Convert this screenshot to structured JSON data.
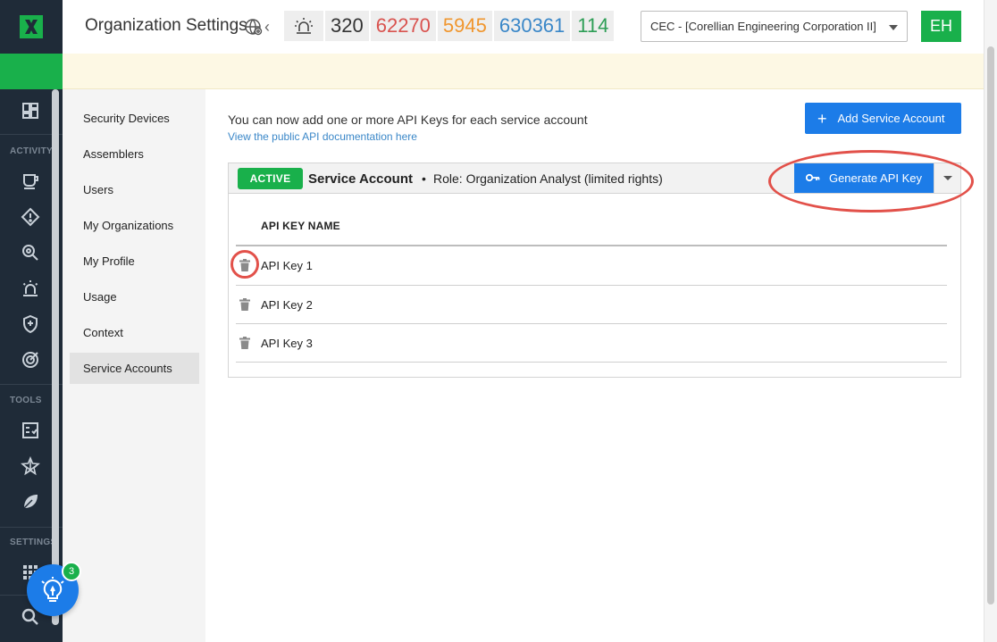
{
  "header": {
    "title": "Organization Settings",
    "stats": [
      {
        "value": "320",
        "color": "#333333"
      },
      {
        "value": "62270",
        "color": "#d9534f"
      },
      {
        "value": "5945",
        "color": "#f0962e"
      },
      {
        "value": "630361",
        "color": "#3a87c8"
      },
      {
        "value": "114",
        "color": "#2e9e56"
      }
    ],
    "org_selected": "CEC - [Corellian Engineering Corporation II]",
    "avatar_initials": "EH"
  },
  "rail": {
    "sections": {
      "activity": "ACTIVITY",
      "tools": "TOOLS",
      "settings": "SETTINGS"
    },
    "icons": [
      "dashboard-icon",
      "activity-cup-icon",
      "alert-diamond-icon",
      "threat-search-icon",
      "alarm-icon",
      "shield-icon",
      "target-icon",
      "checklist-icon",
      "network-star-icon",
      "leaf-icon",
      "grid-icon",
      "search-icon"
    ]
  },
  "subnav": {
    "items": [
      {
        "label": "Security Devices"
      },
      {
        "label": "Assemblers"
      },
      {
        "label": "Users"
      },
      {
        "label": "My Organizations"
      },
      {
        "label": "My Profile"
      },
      {
        "label": "Usage"
      },
      {
        "label": "Context"
      },
      {
        "label": "Service Accounts"
      }
    ],
    "active": "Service Accounts"
  },
  "main": {
    "intro_text": "You can now add one or more API Keys for each service account",
    "doc_link": "View the public API documentation here",
    "add_button": "Add Service Account",
    "account": {
      "status": "ACTIVE",
      "title": "Service Account",
      "separator": "•",
      "role": "Role: Organization Analyst (limited rights)",
      "generate_button": "Generate API Key",
      "column_header": "API KEY NAME",
      "keys": [
        {
          "name": "API Key 1"
        },
        {
          "name": "API Key 2"
        },
        {
          "name": "API Key 3"
        }
      ]
    }
  },
  "help": {
    "badge_count": "3"
  },
  "colors": {
    "brand_green": "#19b04b",
    "primary_blue": "#1c7ce8",
    "rail_bg": "#1f2b38",
    "annotation_red": "#e2514a"
  }
}
